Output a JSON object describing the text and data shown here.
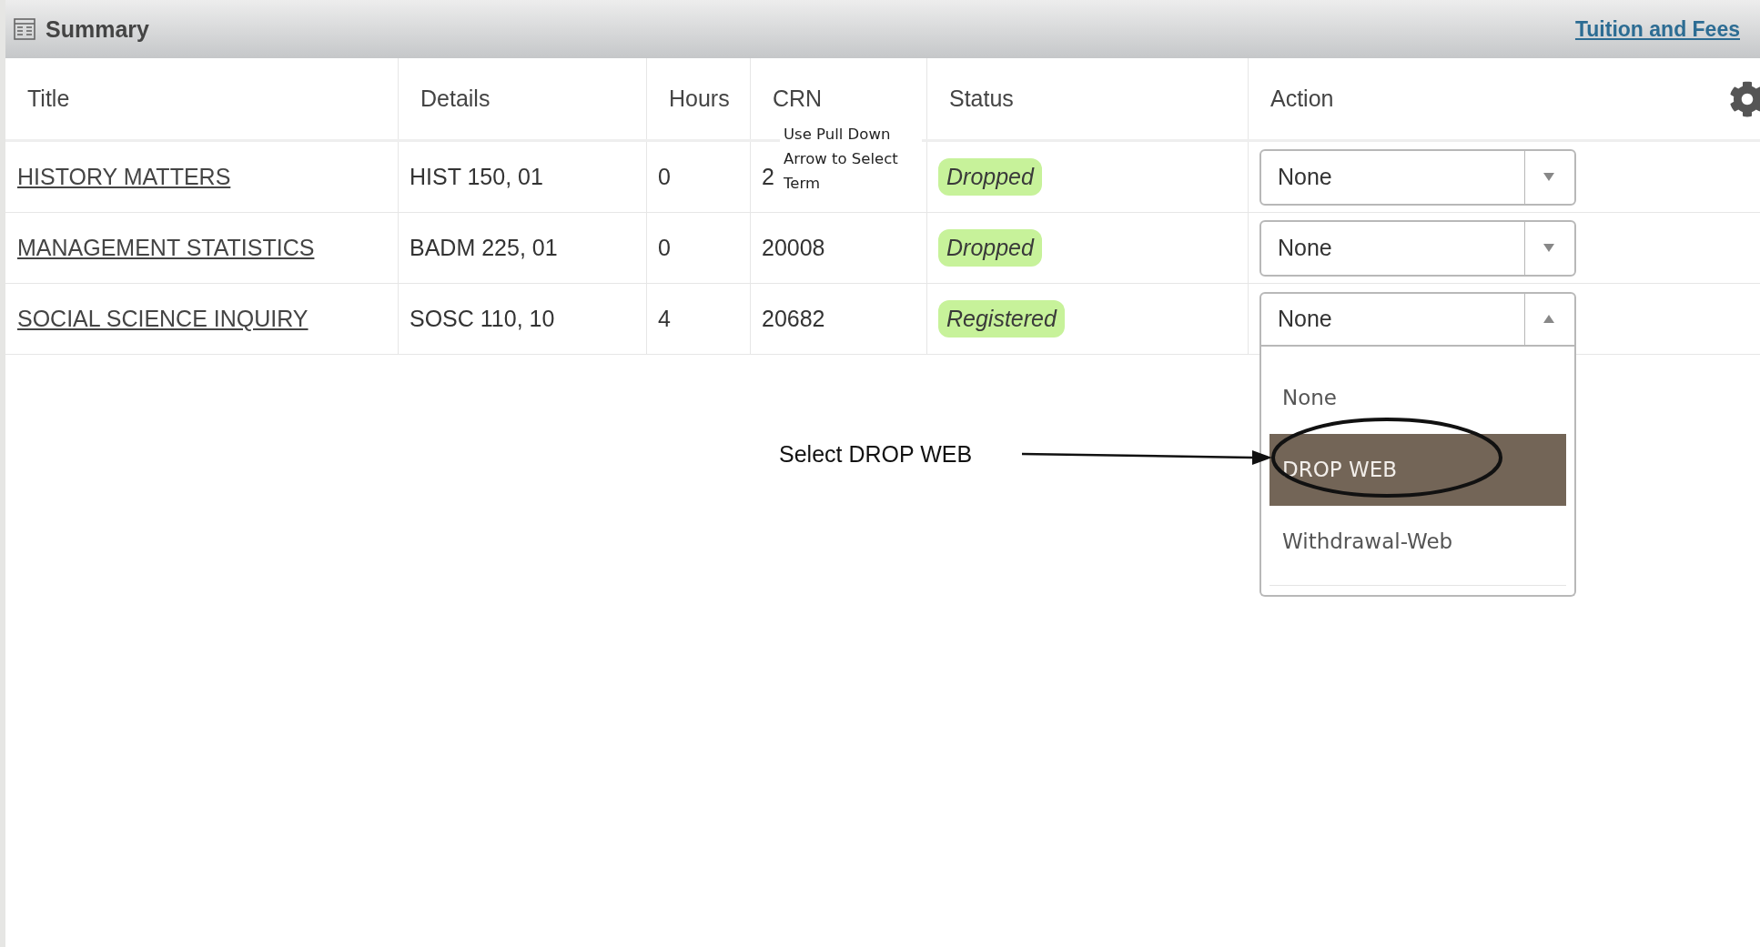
{
  "header": {
    "title": "Summary",
    "link": "Tuition and Fees"
  },
  "table": {
    "columns": [
      "Title",
      "Details",
      "Hours",
      "CRN",
      "Status",
      "Action"
    ],
    "rows": [
      {
        "title": "HISTORY MATTERS",
        "details": "HIST 150, 01",
        "hours": "0",
        "crn": "2",
        "status": "Dropped",
        "action": "None",
        "expanded": false
      },
      {
        "title": "MANAGEMENT STATISTICS",
        "details": "BADM 225, 01",
        "hours": "0",
        "crn": "20008",
        "status": "Dropped",
        "action": "None",
        "expanded": false
      },
      {
        "title": "SOCIAL SCIENCE INQUIRY",
        "details": "SOSC 110, 10",
        "hours": "4",
        "crn": "20682",
        "status": "Registered",
        "action": "None",
        "expanded": true
      }
    ]
  },
  "tooltip": "Use Pull Down Arrow to Select Term",
  "dropdown": {
    "options": [
      {
        "label": "None",
        "selected": false
      },
      {
        "label": "DROP WEB",
        "selected": true
      },
      {
        "label": "Withdrawal-Web",
        "selected": false
      }
    ]
  },
  "annotation": "Select DROP WEB"
}
